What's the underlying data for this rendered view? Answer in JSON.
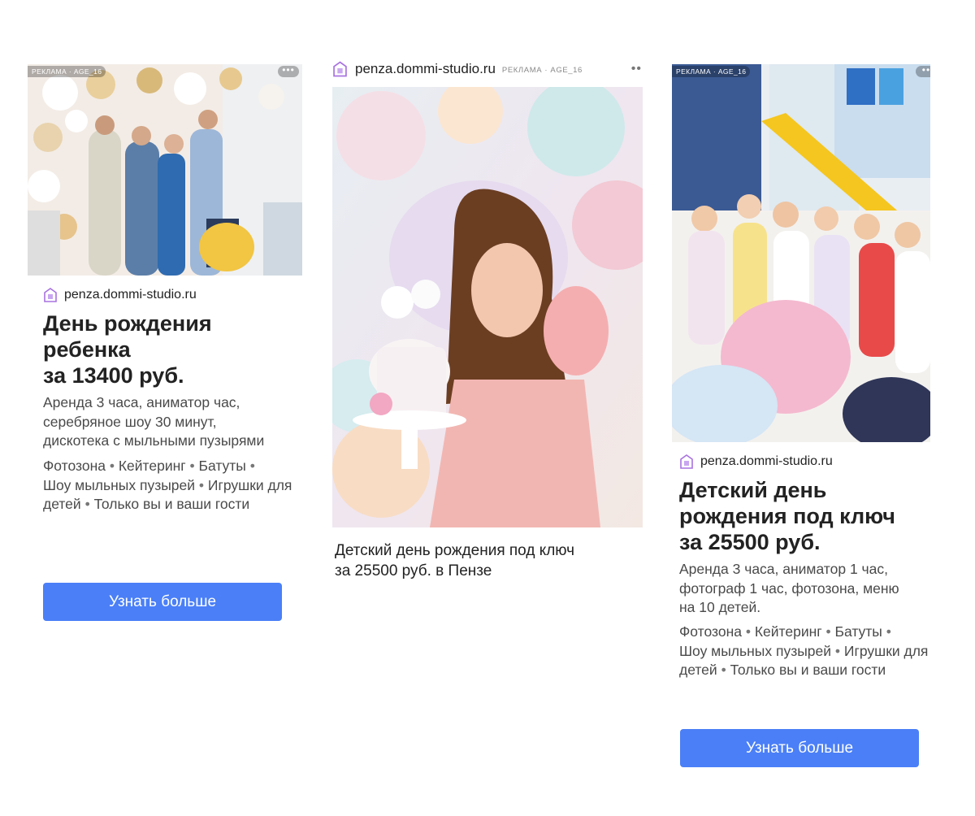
{
  "colors": {
    "button": "#4a7ff7",
    "favicon": "#a872e0",
    "title": "#222222",
    "text": "#4a4a4a"
  },
  "ads": [
    {
      "badge": "РЕКЛАМА · AGE_16",
      "menu_icon": "more-dots-icon",
      "domain": "penza.dommi-studio.ru",
      "title_lines": [
        "День рождения",
        "ребенка",
        "за 13400 руб."
      ],
      "description_lines": [
        "Аренда 3 часа, аниматор час,",
        "серебряное шоу 30 минут,",
        "дискотека с мыльными пузырями"
      ],
      "features": [
        "Фотозона",
        "Кейтеринг",
        "Батуты",
        "Шоу мыльных пузырей",
        "Игрушки для детей",
        "Только вы и ваши гости"
      ],
      "button": "Узнать больше"
    },
    {
      "badge": "РЕКЛАМА · AGE_16",
      "menu_icon": "more-dots-icon",
      "domain": "penza.dommi-studio.ru",
      "caption_lines": [
        "Детский день рождения под ключ",
        "за 25500 руб. в Пензе"
      ]
    },
    {
      "badge": "РЕКЛАМА · AGE_16",
      "menu_icon": "more-dots-icon",
      "domain": "penza.dommi-studio.ru",
      "title_lines": [
        "Детский день",
        "рождения под ключ",
        "за 25500 руб."
      ],
      "description_lines": [
        "Аренда 3 часа, аниматор 1 час,",
        "фотограф 1 час, фотозона, меню",
        "на 10 детей."
      ],
      "features": [
        "Фотозона",
        "Кейтеринг",
        "Батуты",
        "Шоу мыльных пузырей",
        "Игрушки для детей",
        "Только вы и ваши гости"
      ],
      "button": "Узнать больше"
    }
  ]
}
